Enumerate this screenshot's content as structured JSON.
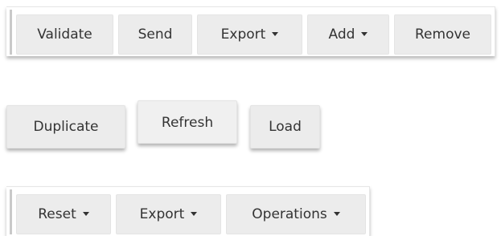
{
  "toolbar1": {
    "buttons": [
      {
        "label": "Validate"
      },
      {
        "label": "Send"
      },
      {
        "label": "Export",
        "dropdown": true
      },
      {
        "label": "Add",
        "dropdown": true
      },
      {
        "label": "Remove"
      }
    ]
  },
  "toolbar2": {
    "buttons": [
      {
        "label": "Duplicate"
      },
      {
        "label": "Refresh"
      },
      {
        "label": "Load"
      }
    ]
  },
  "toolbar3": {
    "buttons": [
      {
        "label": "Reset",
        "dropdown": true
      },
      {
        "label": "Export",
        "dropdown": true
      },
      {
        "label": "Operations",
        "dropdown": true
      }
    ]
  },
  "icons": {
    "dropdown": "caret-down-icon"
  },
  "colors": {
    "button_bg": "#ececec",
    "text": "#333333",
    "toolbar_grip": "#c9c9c9"
  }
}
